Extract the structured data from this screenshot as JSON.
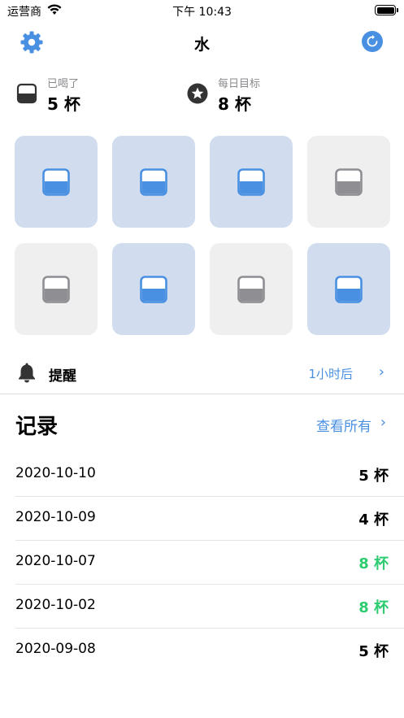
{
  "status_bar": {
    "carrier": "运营商",
    "time": "下午 10:43"
  },
  "navbar": {
    "title": "水",
    "left_icon": "gear-icon",
    "right_icon": "refresh-icon"
  },
  "summary": {
    "drunk": {
      "label": "已喝了",
      "value": "5 杯"
    },
    "goal": {
      "label": "每日目标",
      "value": "8 杯"
    }
  },
  "cups": [
    {
      "filled": true
    },
    {
      "filled": true
    },
    {
      "filled": true
    },
    {
      "filled": false
    },
    {
      "filled": false
    },
    {
      "filled": true
    },
    {
      "filled": false
    },
    {
      "filled": true
    }
  ],
  "reminder": {
    "label": "提醒",
    "value": "1小时后"
  },
  "records": {
    "title": "记录",
    "view_all": "查看所有",
    "items": [
      {
        "date": "2020-10-10",
        "count": "5 杯",
        "goal_met": false
      },
      {
        "date": "2020-10-09",
        "count": "4 杯",
        "goal_met": false
      },
      {
        "date": "2020-10-07",
        "count": "8 杯",
        "goal_met": true
      },
      {
        "date": "2020-10-02",
        "count": "8 杯",
        "goal_met": true
      },
      {
        "date": "2020-09-08",
        "count": "5 杯",
        "goal_met": false
      }
    ]
  },
  "colors": {
    "accent": "#4a90e2",
    "filled_tile": "#d1ddee",
    "empty_tile": "#efefef",
    "empty_cup": "#8e8e93",
    "goal_met": "#2ecc71"
  }
}
